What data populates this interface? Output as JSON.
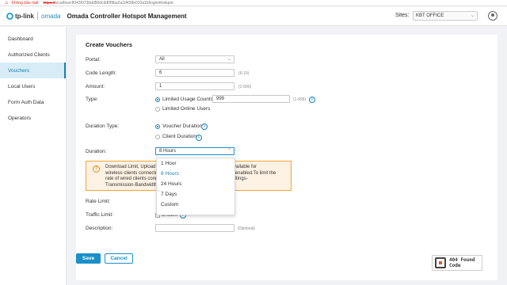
{
  "browser": {
    "warning_text": "Không bảo mật",
    "url_scheme": "https://",
    "url_rest": "localhost:8043/973bdd50dc9d0f9ba2a2d438e010a1b/login#hotspot"
  },
  "header": {
    "logo_tp": "tp-link",
    "logo_omada": "omada",
    "title": "Omada Controller Hotspot Management",
    "sites_label": "Sites:",
    "site_value": "KBT OFFICE"
  },
  "sidebar": {
    "items": [
      {
        "label": "Dashboard"
      },
      {
        "label": "Authorized Clients"
      },
      {
        "label": "Vouchers"
      },
      {
        "label": "Local Users"
      },
      {
        "label": "Form Auth Data"
      },
      {
        "label": "Operators"
      }
    ],
    "active": "Vouchers"
  },
  "form": {
    "title": "Create Vouchers",
    "portal_label": "Portal:",
    "portal_value": "All",
    "code_length_label": "Code Length:",
    "code_length_value": "6",
    "code_length_hint": "(6-10)",
    "amount_label": "Amount:",
    "amount_value": "1",
    "amount_hint": "(1-500)",
    "type_label": "Type:",
    "type_limited_usage": "Limited Usage Counts",
    "type_limited_usage_value": "999",
    "type_limited_usage_hint": "(1-999)",
    "type_limited_online": "Limited Online Users",
    "duration_type_label": "Duration Type:",
    "duration_type_voucher": "Voucher Duration",
    "duration_type_client": "Client Duration",
    "duration_label": "Duration:",
    "duration_value": "8 Hours",
    "notice_text_1": "Download Limit, Upload Li",
    "notice_text_1b": "only available for",
    "notice_text_2": "wireless clients connecte",
    "notice_text_2b": "nction enabled.To limit the",
    "notice_text_3": "rate of wired clients conn",
    "notice_text_3b": "the Settings-",
    "notice_text_4": "Transmission-Bandwidth",
    "rate_limit_label": "Rate Limit:",
    "traffic_limit_label": "Traffic Limit:",
    "traffic_limit_enable": "Enable",
    "description_label": "Description:",
    "description_hint": "(Optional)",
    "save_label": "Save",
    "cancel_label": "Cancel"
  },
  "duration_options": [
    {
      "label": "1 Hour"
    },
    {
      "label": "8 Hours"
    },
    {
      "label": "24 Hours"
    },
    {
      "label": "7 Days"
    },
    {
      "label": "Custom"
    }
  ],
  "stamp": {
    "line1": "404 Found",
    "line2": "Code"
  },
  "colors": {
    "accent": "#1a8fc9",
    "notice_bg": "#fdf2e3",
    "notice_border": "#f0a63c"
  }
}
